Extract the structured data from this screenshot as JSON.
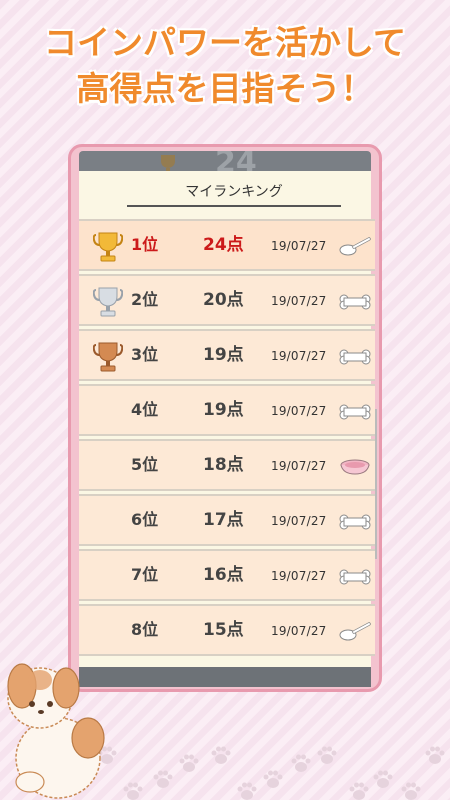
{
  "promo": {
    "line1": "コインパワーを活かして",
    "line2": "高得点を目指そう！"
  },
  "screen": {
    "ghost_score": "24",
    "title": "マイランキング",
    "rows": [
      {
        "rank": "1位",
        "score": "24点",
        "date": "19/07/27",
        "trophy": "gold",
        "item": "spoon"
      },
      {
        "rank": "2位",
        "score": "20点",
        "date": "19/07/27",
        "trophy": "silver",
        "item": "bone"
      },
      {
        "rank": "3位",
        "score": "19点",
        "date": "19/07/27",
        "trophy": "bronze",
        "item": "bone"
      },
      {
        "rank": "4位",
        "score": "19点",
        "date": "19/07/27",
        "trophy": "",
        "item": "bone"
      },
      {
        "rank": "5位",
        "score": "18点",
        "date": "19/07/27",
        "trophy": "",
        "item": "bowl"
      },
      {
        "rank": "6位",
        "score": "17点",
        "date": "19/07/27",
        "trophy": "",
        "item": "bone"
      },
      {
        "rank": "7位",
        "score": "16点",
        "date": "19/07/27",
        "trophy": "",
        "item": "bone"
      },
      {
        "rank": "8位",
        "score": "15点",
        "date": "19/07/27",
        "trophy": "",
        "item": "spoon"
      }
    ]
  },
  "colors": {
    "headline": "#f08a2c",
    "first_place": "#cc1a1a",
    "row_bg": "#fde9d6",
    "frame": "#e89aae"
  }
}
